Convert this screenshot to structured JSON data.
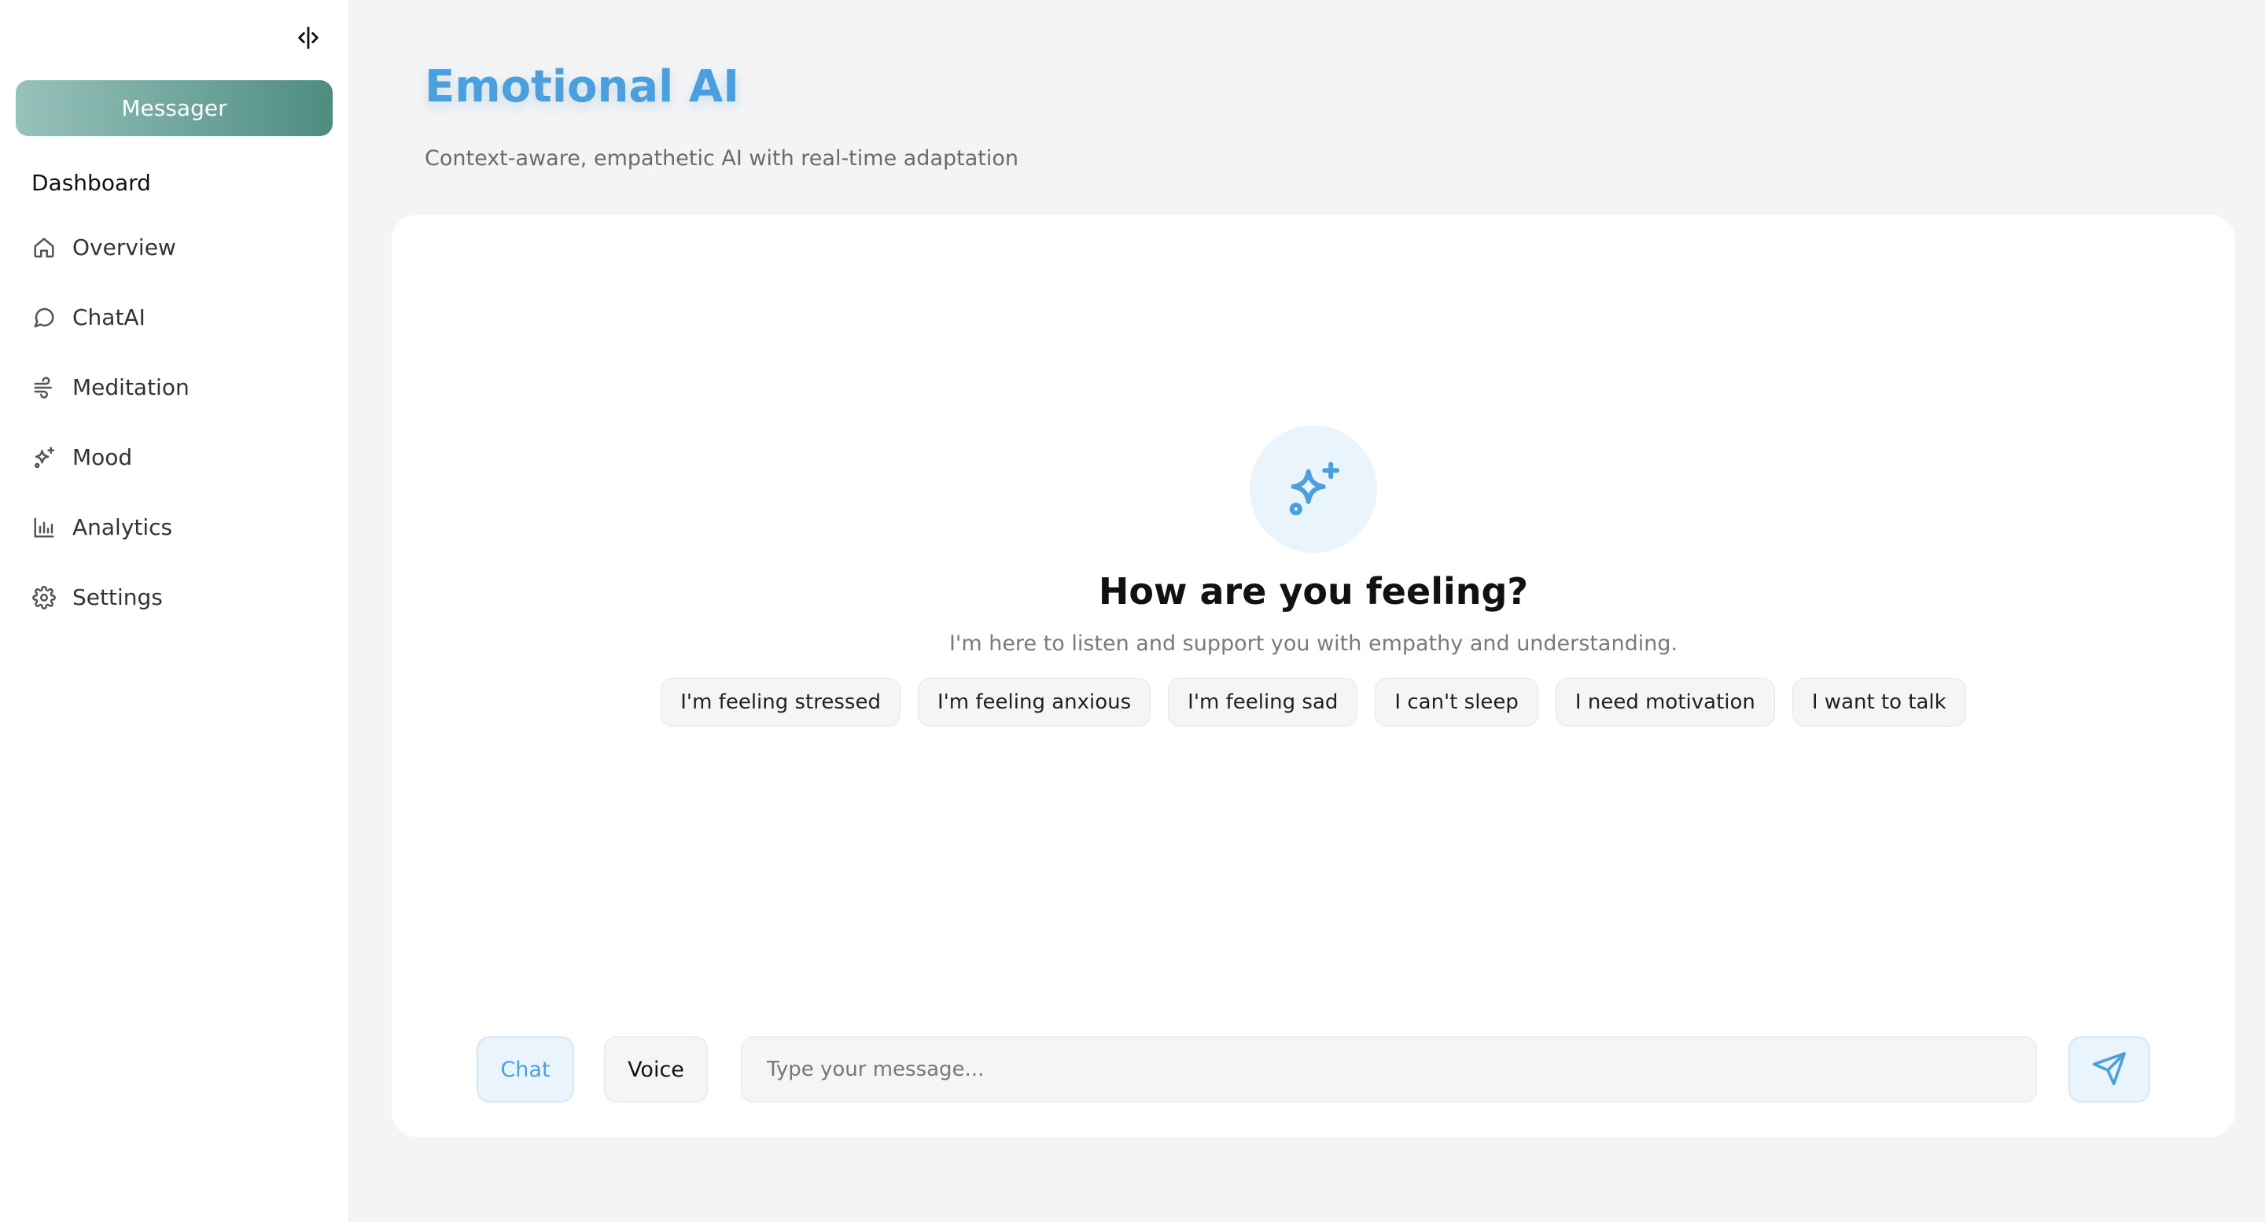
{
  "sidebar": {
    "toggle_icon": "panel-collapse-icon",
    "primary_button": "Messager",
    "heading": "Dashboard",
    "items": [
      {
        "label": "Overview",
        "icon": "home-icon"
      },
      {
        "label": "ChatAI",
        "icon": "chat-bubble-icon"
      },
      {
        "label": "Meditation",
        "icon": "wind-icon"
      },
      {
        "label": "Mood",
        "icon": "sparkles-icon"
      },
      {
        "label": "Analytics",
        "icon": "bar-chart-icon"
      },
      {
        "label": "Settings",
        "icon": "gear-icon"
      }
    ]
  },
  "header": {
    "title": "Emotional AI",
    "subtitle": "Context-aware, empathetic AI with real-time adaptation"
  },
  "chat": {
    "empty_icon": "sparkles-icon",
    "empty_title": "How are you feeling?",
    "empty_description": "I'm here to listen and support you with empathy and understanding.",
    "suggestions": [
      "I'm feeling stressed",
      "I'm feeling anxious",
      "I'm feeling sad",
      "I can't sleep",
      "I need motivation",
      "I want to talk"
    ],
    "modes": {
      "chat": "Chat",
      "voice": "Voice",
      "active": "Chat"
    },
    "input": {
      "placeholder": "Type your message...",
      "value": ""
    },
    "send_icon": "send-icon"
  },
  "colors": {
    "accent": "#4a9fdc",
    "accent_soft": "#eaf4fc",
    "brand_gradient_start": "#97c2bb",
    "brand_gradient_end": "#4e8c80",
    "background": "#f4f4f4"
  }
}
